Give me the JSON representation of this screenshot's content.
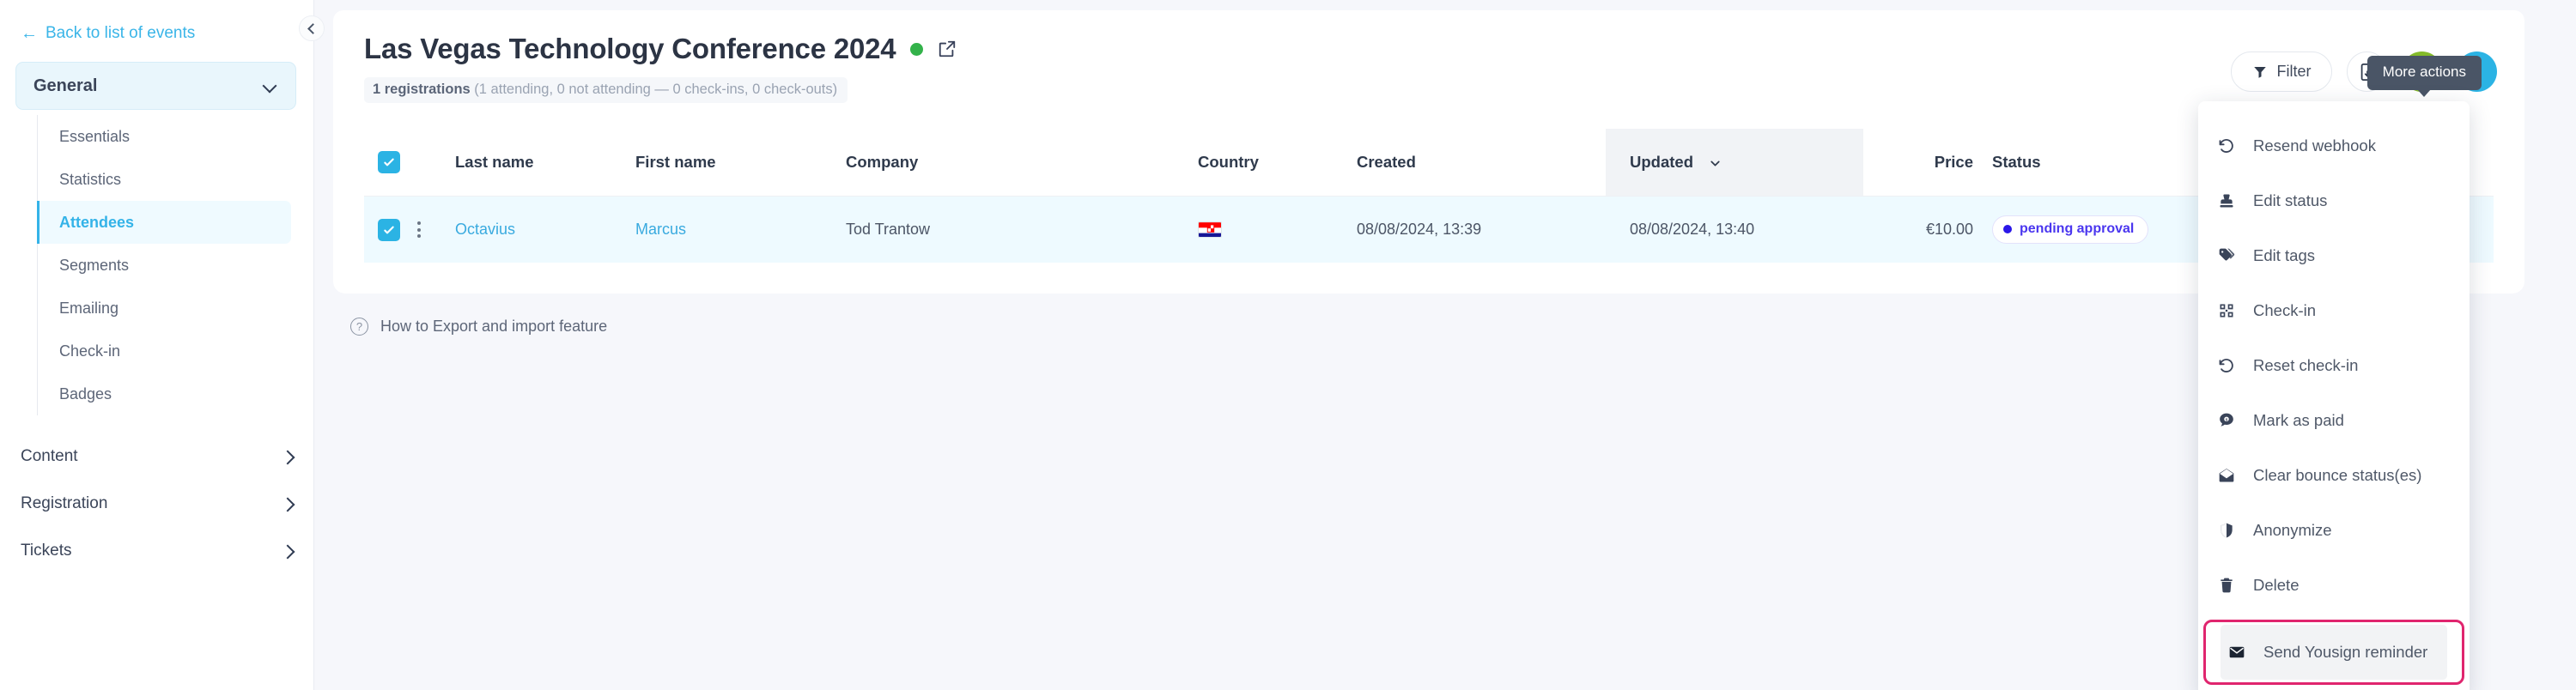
{
  "sidebar": {
    "back_link": "Back to list of events",
    "back_icon": "arrow-left-icon",
    "group_label": "General",
    "group_chevron_icon": "chevron-down-icon",
    "sub_items": [
      {
        "label": "Essentials",
        "active": false
      },
      {
        "label": "Statistics",
        "active": false
      },
      {
        "label": "Attendees",
        "active": true
      },
      {
        "label": "Segments",
        "active": false
      },
      {
        "label": "Emailing",
        "active": false
      },
      {
        "label": "Check-in",
        "active": false
      },
      {
        "label": "Badges",
        "active": false
      }
    ],
    "sections": [
      {
        "label": "Content",
        "chevron_icon": "chevron-right-icon"
      },
      {
        "label": "Registration",
        "chevron_icon": "chevron-right-icon"
      },
      {
        "label": "Tickets",
        "chevron_icon": "chevron-right-icon"
      }
    ],
    "collapse_icon": "chevron-left-icon"
  },
  "header": {
    "title": "Las Vegas Technology Conference 2024",
    "status_dot_color": "#33b24a",
    "status_dot_icon": "green-status-dot-icon",
    "external_link_icon": "external-link-icon",
    "subtitle_prefix": "1 registrations",
    "subtitle_rest": " (1 attending, 0 not attending — 0 check-ins, 0 check-outs)"
  },
  "toolbar": {
    "filter_label": "Filter",
    "filter_icon": "funnel-icon",
    "export_icon": "file-download-icon",
    "settings_icon": "gear-icon",
    "more_icon": "kebab-vertical-icon",
    "tooltip": "More actions",
    "settings_color": "#84bb2a",
    "more_color": "#2bb3e4"
  },
  "table": {
    "select_all_icon": "checkbox-checked-icon",
    "columns": [
      {
        "key": "last_name",
        "label": "Last name"
      },
      {
        "key": "first_name",
        "label": "First name"
      },
      {
        "key": "company",
        "label": "Company"
      },
      {
        "key": "country",
        "label": "Country"
      },
      {
        "key": "created",
        "label": "Created"
      },
      {
        "key": "updated",
        "label": "Updated",
        "sorted": true,
        "sort_icon": "chevron-down-icon"
      },
      {
        "key": "price",
        "label": "Price"
      },
      {
        "key": "status",
        "label": "Status"
      }
    ],
    "rows": [
      {
        "checked": true,
        "row_menu_icon": "kebab-vertical-icon",
        "last_name": "Octavius",
        "first_name": "Marcus",
        "company": "Tod Trantow",
        "country_flag_icon": "croatia-flag-icon",
        "created": "08/08/2024, 13:39",
        "updated": "08/08/2024, 13:40",
        "price": "€10.00",
        "status": "pending approval",
        "status_color": "#4a36ef"
      }
    ]
  },
  "footer": {
    "help_icon": "question-circle-icon",
    "help_label": "How to Export and import feature"
  },
  "menu": {
    "items": [
      {
        "label": "Resend webhook",
        "icon": "undo-arrow-icon"
      },
      {
        "label": "Edit status",
        "icon": "stamp-icon"
      },
      {
        "label": "Edit tags",
        "icon": "tags-icon"
      },
      {
        "label": "Check-in",
        "icon": "qr-scan-icon"
      },
      {
        "label": "Reset check-in",
        "icon": "undo-arrow-icon"
      },
      {
        "label": "Mark as paid",
        "icon": "coin-chat-icon"
      },
      {
        "label": "Clear bounce status(es)",
        "icon": "open-envelope-icon"
      },
      {
        "label": "Anonymize",
        "icon": "shield-half-icon"
      },
      {
        "label": "Delete",
        "icon": "trash-icon"
      }
    ],
    "highlighted": {
      "label": "Send Yousign reminder",
      "icon": "envelope-icon",
      "ring_color": "#e0256e"
    }
  }
}
